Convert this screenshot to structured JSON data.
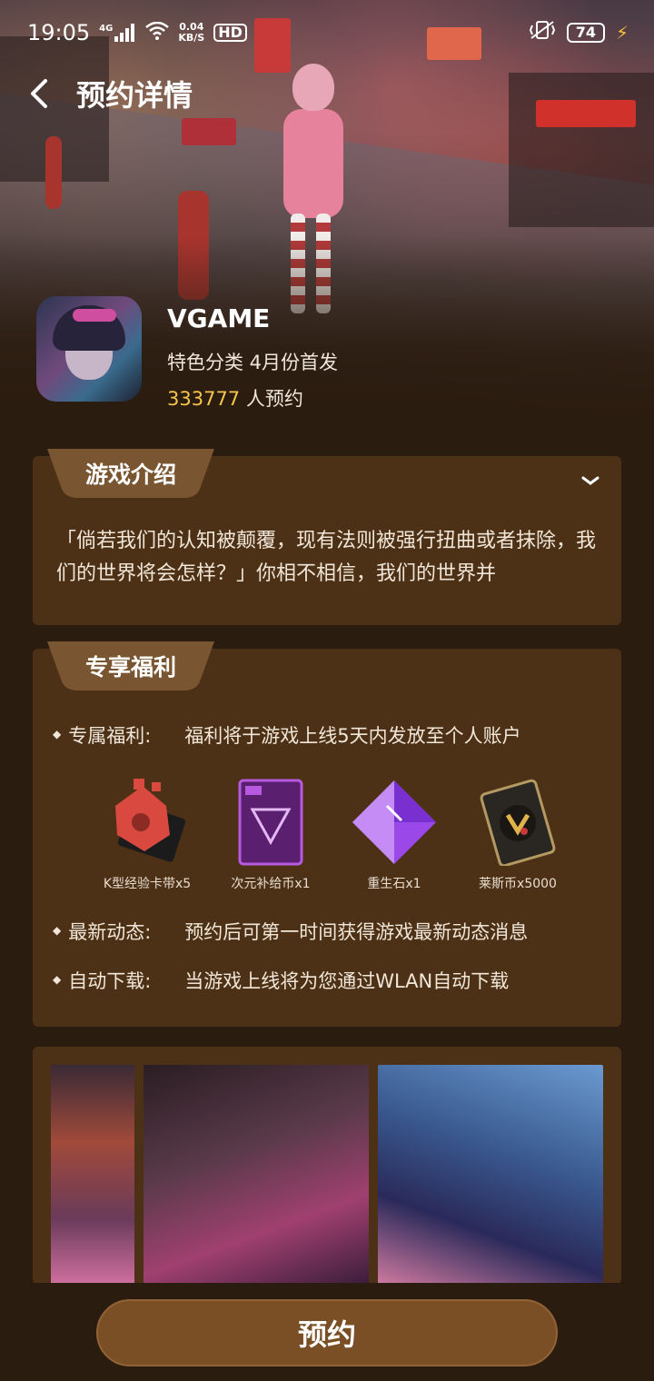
{
  "status_bar": {
    "time": "19:05",
    "signal": "4G",
    "net_speed_value": "0.04",
    "net_speed_unit": "KB/S",
    "hd": "HD",
    "battery": "74"
  },
  "header": {
    "title": "预约详情"
  },
  "app": {
    "name": "VGAME",
    "subtitle": "特色分类 4月份首发",
    "reserve_count": "333777",
    "reserve_suffix": " 人预约"
  },
  "intro": {
    "tab_label": "游戏介绍",
    "text": "「倘若我们的认知被颠覆，现有法则被强行扭曲或者抹除，我们的世界将会怎样？」你相不相信，我们的世界并"
  },
  "benefits": {
    "tab_label": "专享福利",
    "rows": [
      {
        "label": "专属福利:",
        "text": "福利将于游戏上线5天内发放至个人账户"
      },
      {
        "label": "最新动态:",
        "text": "预约后可第一时间获得游戏最新动态消息"
      },
      {
        "label": "自动下载:",
        "text": "当游戏上线将为您通过WLAN自动下载"
      }
    ],
    "items": [
      {
        "caption": "K型经验卡带x5",
        "icon": "cartridge-icon"
      },
      {
        "caption": "次元补给币x1",
        "icon": "purple-card-icon"
      },
      {
        "caption": "重生石x1",
        "icon": "crystal-icon"
      },
      {
        "caption": "莱斯币x5000",
        "icon": "coin-card-icon"
      }
    ]
  },
  "bottom": {
    "reserve_label": "预约"
  },
  "colors": {
    "background": "#2b1c10",
    "card": "#4c3117",
    "tab": "#7a5532",
    "accent_number": "#f5c64a",
    "button": "#7a4f26"
  }
}
